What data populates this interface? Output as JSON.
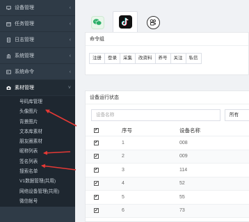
{
  "sidebar": {
    "items": [
      {
        "label": "设备管理",
        "icon": "monitor-icon"
      },
      {
        "label": "任务管理",
        "icon": "calendar-icon"
      },
      {
        "label": "日志管理",
        "icon": "document-icon"
      },
      {
        "label": "系统管理",
        "icon": "bank-icon"
      },
      {
        "label": "系统命令",
        "icon": "terminal-icon"
      }
    ],
    "active_item": {
      "label": "素材管理",
      "icon": "camera-icon"
    },
    "submenu": [
      "号码库管理",
      "头像图片",
      "背景图片",
      "文本库素材",
      "朋友圈素材",
      "昵称列表",
      "签名列表",
      "搜索名单",
      "V1数据管理(共用)",
      "网络设备管理(共用)",
      "微信帐号"
    ]
  },
  "app_tabs": [
    {
      "name": "wechat",
      "icon": "wechat-icon"
    },
    {
      "name": "tiktok",
      "icon": "tiktok-icon"
    },
    {
      "name": "kuaishou",
      "icon": "kuaishou-icon"
    }
  ],
  "command_panel": {
    "title": "命令组",
    "buttons": [
      "注册",
      "登录",
      "采集",
      "改资料",
      "养号",
      "关注",
      "私信"
    ]
  },
  "status_panel": {
    "title": "设备运行状态",
    "search_placeholder": "设备名称",
    "filter_value": "所有",
    "columns": [
      "序号",
      "设备名称"
    ],
    "rows": [
      {
        "num": "1",
        "name": "008"
      },
      {
        "num": "2",
        "name": "009"
      },
      {
        "num": "3",
        "name": "114"
      },
      {
        "num": "4",
        "name": "52"
      },
      {
        "num": "5",
        "name": "55"
      },
      {
        "num": "6",
        "name": "73"
      },
      {
        "num": "7",
        "name": "82"
      }
    ]
  },
  "colors": {
    "sidebar_bg": "#2f3b47",
    "annotation_arrow": "#e53935"
  }
}
